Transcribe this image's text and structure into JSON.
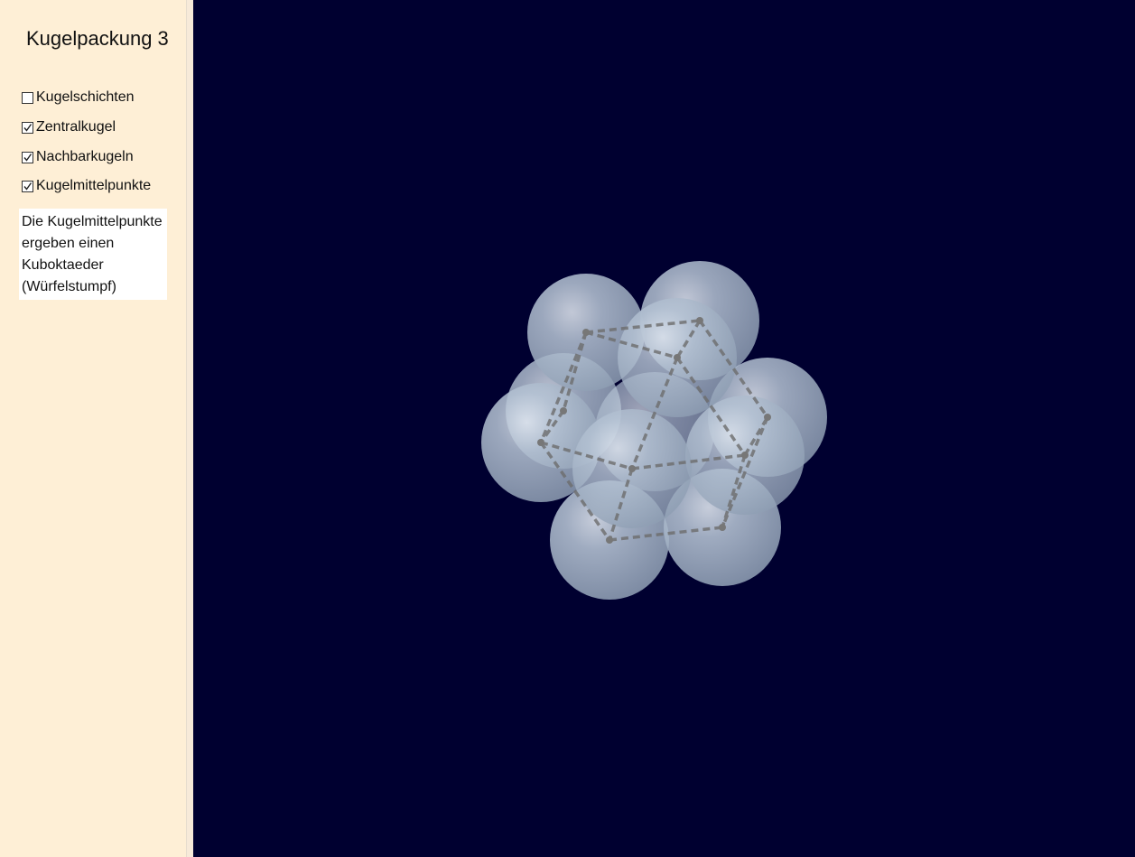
{
  "title": "Kugelpackung 3",
  "checkboxes": [
    {
      "label": "Kugelschichten",
      "checked": false
    },
    {
      "label": "Zentralkugel",
      "checked": true
    },
    {
      "label": "Nachbarkugeln",
      "checked": true
    },
    {
      "label": "Kugelmittelpunkte",
      "checked": true
    }
  ],
  "info": {
    "line1": "Die Kugelmittelpunkte",
    "line2": "ergeben einen",
    "line3": "Kuboktaeder",
    "line4": "(Würfelstumpf)"
  },
  "colors": {
    "sidebar_bg": "#feefd6",
    "view_bg": "#000030",
    "sphere": "#a9b8cb",
    "edge": "#6d6d6d"
  }
}
